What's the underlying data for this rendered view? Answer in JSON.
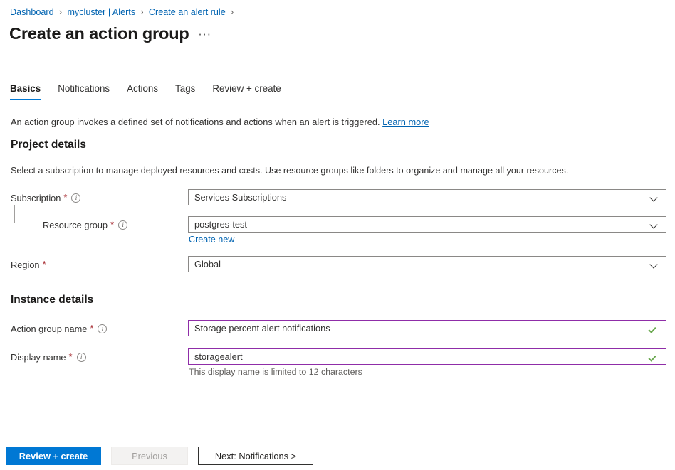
{
  "breadcrumb": {
    "separator": "›",
    "items": [
      {
        "label": "Dashboard"
      },
      {
        "label": "mycluster | Alerts"
      },
      {
        "label": "Create an alert rule"
      }
    ]
  },
  "header": {
    "title": "Create an action group",
    "more_menu": "···"
  },
  "tabs": [
    {
      "label": "Basics",
      "active": true
    },
    {
      "label": "Notifications",
      "active": false
    },
    {
      "label": "Actions",
      "active": false
    },
    {
      "label": "Tags",
      "active": false
    },
    {
      "label": "Review + create",
      "active": false
    }
  ],
  "intro": {
    "text": "An action group invokes a defined set of notifications and actions when an alert is triggered.",
    "link_label": "Learn more"
  },
  "project_details": {
    "heading": "Project details",
    "description": "Select a subscription to manage deployed resources and costs. Use resource groups like folders to organize and manage all your resources.",
    "subscription": {
      "label": "Subscription",
      "required": "*",
      "info": "i",
      "value": "Services Subscriptions",
      "chevron": "chevron-down-icon"
    },
    "resource_group": {
      "label": "Resource group",
      "required": "*",
      "info": "i",
      "value": "postgres-test",
      "create_new_label": "Create new",
      "chevron": "chevron-down-icon"
    },
    "region": {
      "label": "Region",
      "required": "*",
      "value": "Global",
      "chevron": "chevron-down-icon"
    }
  },
  "instance_details": {
    "heading": "Instance details",
    "action_group_name": {
      "label": "Action group name",
      "required": "*",
      "info": "i",
      "value": "Storage percent alert notifications",
      "validation": "valid-check-icon"
    },
    "display_name": {
      "label": "Display name",
      "required": "*",
      "info": "i",
      "value": "storagealert",
      "helper": "This display name is limited to 12 characters",
      "validation": "valid-check-icon"
    }
  },
  "footer": {
    "review_create": "Review + create",
    "previous": "Previous",
    "next": "Next: Notifications >"
  },
  "colors": {
    "accent": "#0078d4",
    "link": "#0063b1",
    "required": "#a4262c",
    "valid_border": "#8f2da8",
    "valid_check": "#6aa84f"
  }
}
